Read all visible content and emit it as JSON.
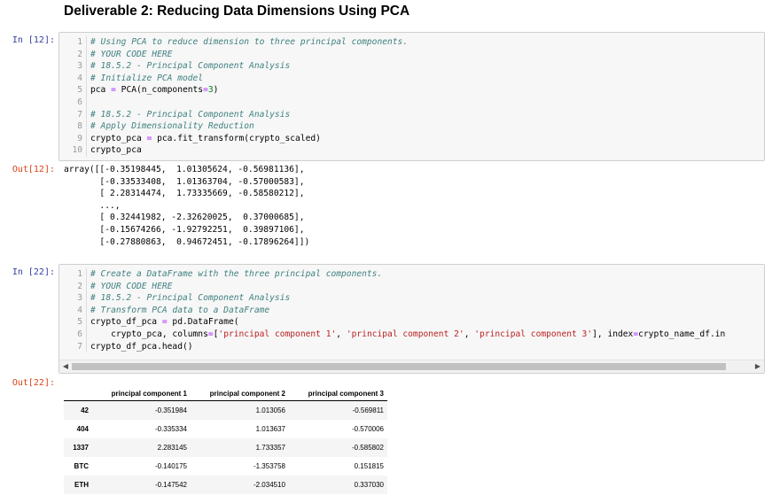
{
  "heading": "Deliverable 2: Reducing Data Dimensions Using PCA",
  "cell1": {
    "in_prompt": "In [12]:",
    "out_prompt": "Out[12]:",
    "lines": [
      {
        "no": "1",
        "text": "# Using PCA to reduce dimension to three principal components."
      },
      {
        "no": "2",
        "text": "# YOUR CODE HERE"
      },
      {
        "no": "3",
        "text": "# 18.5.2 - Principal Component Analysis"
      },
      {
        "no": "4",
        "text": "# Initialize PCA model"
      },
      {
        "no": "5",
        "text": "pca = PCA(n_components=3)"
      },
      {
        "no": "6",
        "text": ""
      },
      {
        "no": "7",
        "text": "# 18.5.2 - Principal Component Analysis"
      },
      {
        "no": "8",
        "text": "# Apply Dimensionality Reduction"
      },
      {
        "no": "9",
        "text": "crypto_pca = pca.fit_transform(crypto_scaled)"
      },
      {
        "no": "10",
        "text": "crypto_pca"
      }
    ],
    "output_lines": [
      "array([[-0.35198445,  1.01305624, -0.56981136],",
      "       [-0.33533408,  1.01363704, -0.57000583],",
      "       [ 2.28314474,  1.73335669, -0.58580212],",
      "       ...,",
      "       [ 0.32441982, -2.32620025,  0.37000685],",
      "       [-0.15674266, -1.92792251,  0.39897106],",
      "       [-0.27880863,  0.94672451, -0.17896264]])"
    ]
  },
  "cell2": {
    "in_prompt": "In [22]:",
    "out_prompt": "Out[22]:",
    "lines": [
      {
        "no": "1",
        "text": "# Create a DataFrame with the three principal components."
      },
      {
        "no": "2",
        "text": "# YOUR CODE HERE"
      },
      {
        "no": "3",
        "text": "# 18.5.2 - Principal Component Analysis"
      },
      {
        "no": "4",
        "text": "# Transform PCA data to a DataFrame"
      },
      {
        "no": "5",
        "text": "crypto_df_pca = pd.DataFrame("
      },
      {
        "no": "6",
        "text": "    crypto_pca, columns=['principal component 1', 'principal component 2', 'principal component 3'], index=crypto_name_df.in"
      },
      {
        "no": "7",
        "text": "crypto_df_pca.head()"
      }
    ],
    "scroll_left": "◀",
    "scroll_right": "▶"
  },
  "table": {
    "columns": [
      "",
      "principal component 1",
      "principal component 2",
      "principal component 3"
    ],
    "rows": [
      {
        "index": "42",
        "values": [
          "-0.351984",
          "1.013056",
          "-0.569811"
        ]
      },
      {
        "index": "404",
        "values": [
          "-0.335334",
          "1.013637",
          "-0.570006"
        ]
      },
      {
        "index": "1337",
        "values": [
          "2.283145",
          "1.733357",
          "-0.585802"
        ]
      },
      {
        "index": "BTC",
        "values": [
          "-0.140175",
          "-1.353758",
          "0.151815"
        ]
      },
      {
        "index": "ETH",
        "values": [
          "-0.147542",
          "-2.034510",
          "0.337030"
        ]
      }
    ]
  },
  "colors": {
    "in_prompt": "#303F9F",
    "out_prompt": "#D84315",
    "comment": "#408080",
    "string": "#BA2121",
    "number": "#008800",
    "operator": "#AA22FF"
  }
}
